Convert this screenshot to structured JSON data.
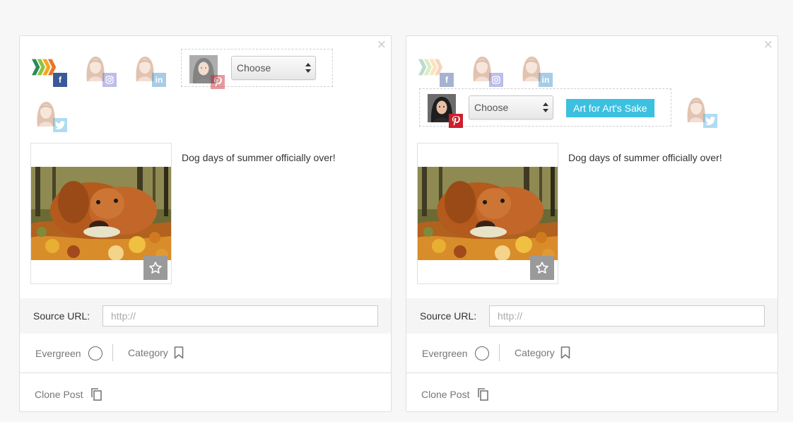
{
  "colors": {
    "facebook": "#3b5998",
    "instagram": "#6f6fd0",
    "linkedin": "#3d90c8",
    "twitter": "#4fb2e6",
    "pinterest": "#cc1f2b",
    "tag_button": "#3cc0e0",
    "card_border": "#dedede"
  },
  "cards": [
    {
      "close_icon": "×",
      "accounts": [
        {
          "icon": "brand-chevrons-icon",
          "network": "facebook-icon",
          "state": "active"
        },
        {
          "icon": "avatar-woman-icon",
          "network": "instagram-icon",
          "state": "faded"
        },
        {
          "icon": "avatar-woman-icon",
          "network": "linkedin-icon",
          "state": "faded"
        },
        {
          "icon": "avatar-woman-icon",
          "network": "twitter-icon",
          "state": "faded"
        }
      ],
      "pinterest_group": {
        "network": "pinterest-icon",
        "state": "faded",
        "select_value": "Choose"
      },
      "caption": "Dog days of summer officially over!",
      "favorite_icon": "star-icon",
      "source": {
        "label": "Source URL:",
        "placeholder": "http://"
      },
      "options": {
        "evergreen_label": "Evergreen",
        "category_label": "Category"
      },
      "clone_label": "Clone Post"
    },
    {
      "close_icon": "×",
      "accounts": [
        {
          "icon": "brand-chevrons-icon",
          "network": "facebook-icon",
          "state": "faded"
        },
        {
          "icon": "avatar-woman-icon",
          "network": "instagram-icon",
          "state": "faded"
        },
        {
          "icon": "avatar-woman-icon",
          "network": "linkedin-icon",
          "state": "faded"
        },
        {
          "icon": "avatar-woman-icon",
          "network": "twitter-icon",
          "state": "faded"
        }
      ],
      "pinterest_group": {
        "network": "pinterest-icon",
        "state": "active",
        "select_value": "Choose",
        "board_button": "Art for Art's Sake"
      },
      "caption": "Dog days of summer officially over!",
      "favorite_icon": "star-icon",
      "source": {
        "label": "Source URL:",
        "placeholder": "http://"
      },
      "options": {
        "evergreen_label": "Evergreen",
        "category_label": "Category"
      },
      "clone_label": "Clone Post"
    }
  ]
}
